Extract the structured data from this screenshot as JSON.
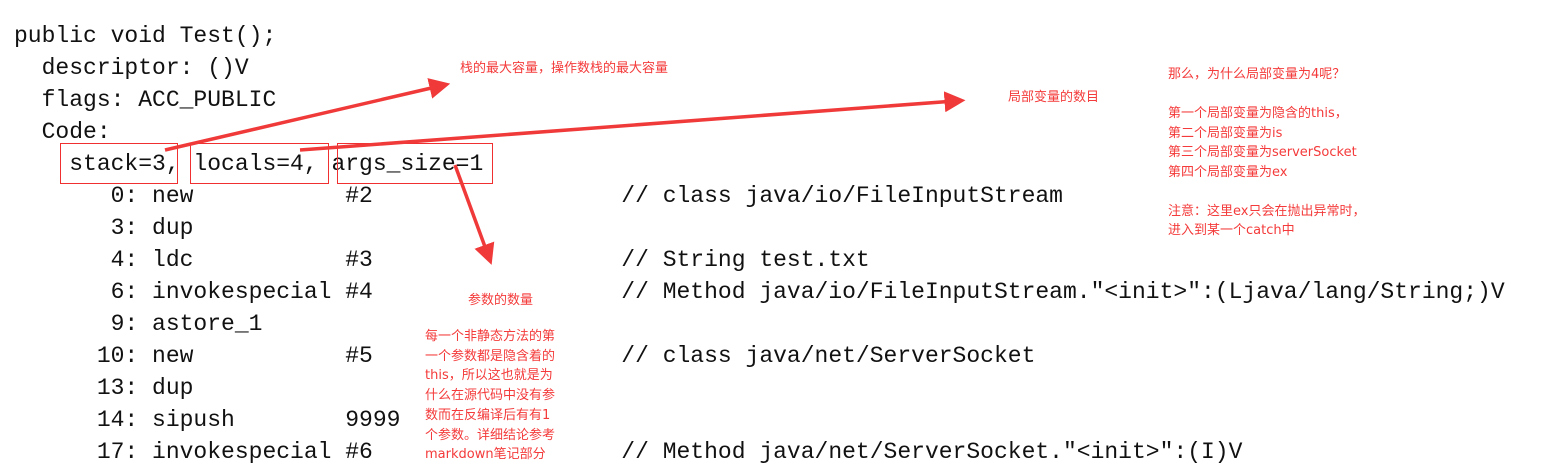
{
  "code_lines": [
    "public void Test();",
    "  descriptor: ()V",
    "  flags: ACC_PUBLIC",
    "  Code:",
    "    stack=3, locals=4, args_size=1",
    "       0: new           #2                  // class java/io/FileInputStream",
    "       3: dup",
    "       4: ldc           #3                  // String test.txt",
    "       6: invokespecial #4                  // Method java/io/FileInputStream.\"<init>\":(Ljava/lang/String;)V",
    "       9: astore_1",
    "      10: new           #5                  // class java/net/ServerSocket",
    "      13: dup",
    "      14: sipush        9999",
    "      17: invokespecial #6                  // Method java/net/ServerSocket.\"<init>\":(I)V"
  ],
  "annotations": {
    "stack_note": "栈的最大容量，操作数栈的最大容量",
    "locals_note": "局部变量的数目",
    "args_title": "参数的数量",
    "args_detail": "每一个非静态方法的第\n一个参数都是隐含着的\nthis，所以这也就是为\n什么在源代码中没有参\n数而在反编译后有有1\n个参数。详细结论参考\nmarkdown笔记部分",
    "locals_detail": "那么，为什么局部变量为4呢？\n\n第一个局部变量为隐含的this，\n第二个局部变量为is\n第三个局部变量为serverSocket\n第四个局部变量为ex\n\n注意：这里ex只会在抛出异常时，\n进入到某一个catch中"
  },
  "colors": {
    "annotation": "#f43a3a",
    "code": "#111111"
  }
}
